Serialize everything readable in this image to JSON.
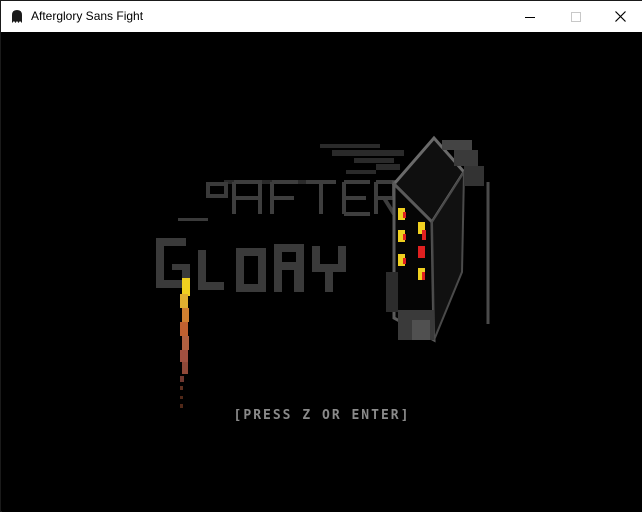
{
  "window": {
    "title": "Afterglory Sans Fight",
    "app_icon": "ghost-icon",
    "controls": [
      "minimize-icon",
      "maximize-icon",
      "close-icon"
    ]
  },
  "game": {
    "logo": {
      "line1": "AFTER",
      "line2": "GLORY"
    },
    "prompt": "[PRESS Z OR ENTER]"
  },
  "colors": {
    "background": "#000000",
    "logo_gray": "#3a3a3a",
    "prompt_gray": "#8a8a8a",
    "window_red": "#e02020",
    "window_yellow": "#f0d020",
    "chain_orange": "#c06030"
  }
}
